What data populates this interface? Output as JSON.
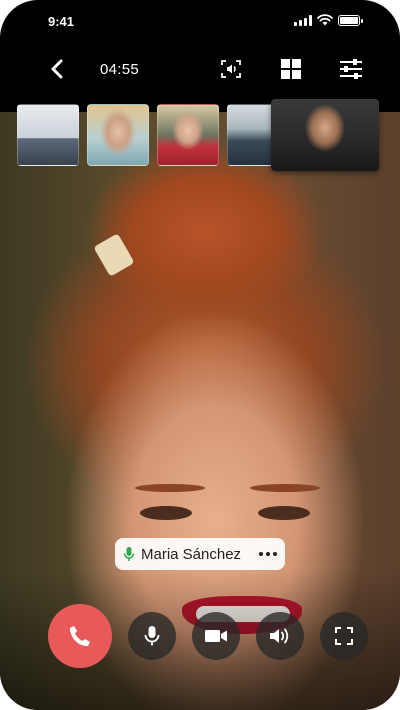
{
  "status_bar": {
    "time": "9:41",
    "icons": [
      "signal-icon",
      "wifi-icon",
      "battery-icon"
    ]
  },
  "top_bar": {
    "call_timer": "04:55",
    "icons": [
      "back-arrow-icon",
      "screen-share-audio-icon",
      "grid-layout-icon",
      "settings-sliders-icon"
    ]
  },
  "participants": [
    {
      "thumb": "participant-1",
      "active": false
    },
    {
      "thumb": "participant-2",
      "active": false
    },
    {
      "thumb": "participant-3",
      "active": false
    },
    {
      "thumb": "participant-4",
      "active": false
    },
    {
      "thumb": "participant-5",
      "active": true
    }
  ],
  "speaker": {
    "name": "Maria Sánchez",
    "mic_icon": "mic-icon",
    "more_icon": "more-horizontal-icon"
  },
  "controls": {
    "icons": [
      "end-call-icon",
      "microphone-icon",
      "video-camera-icon",
      "speaker-volume-icon",
      "fullscreen-icon"
    ]
  },
  "colors": {
    "end_call": "#e85a5a",
    "control_bg": "#282828",
    "mic_active": "#2fa84f",
    "background": "#000000"
  }
}
